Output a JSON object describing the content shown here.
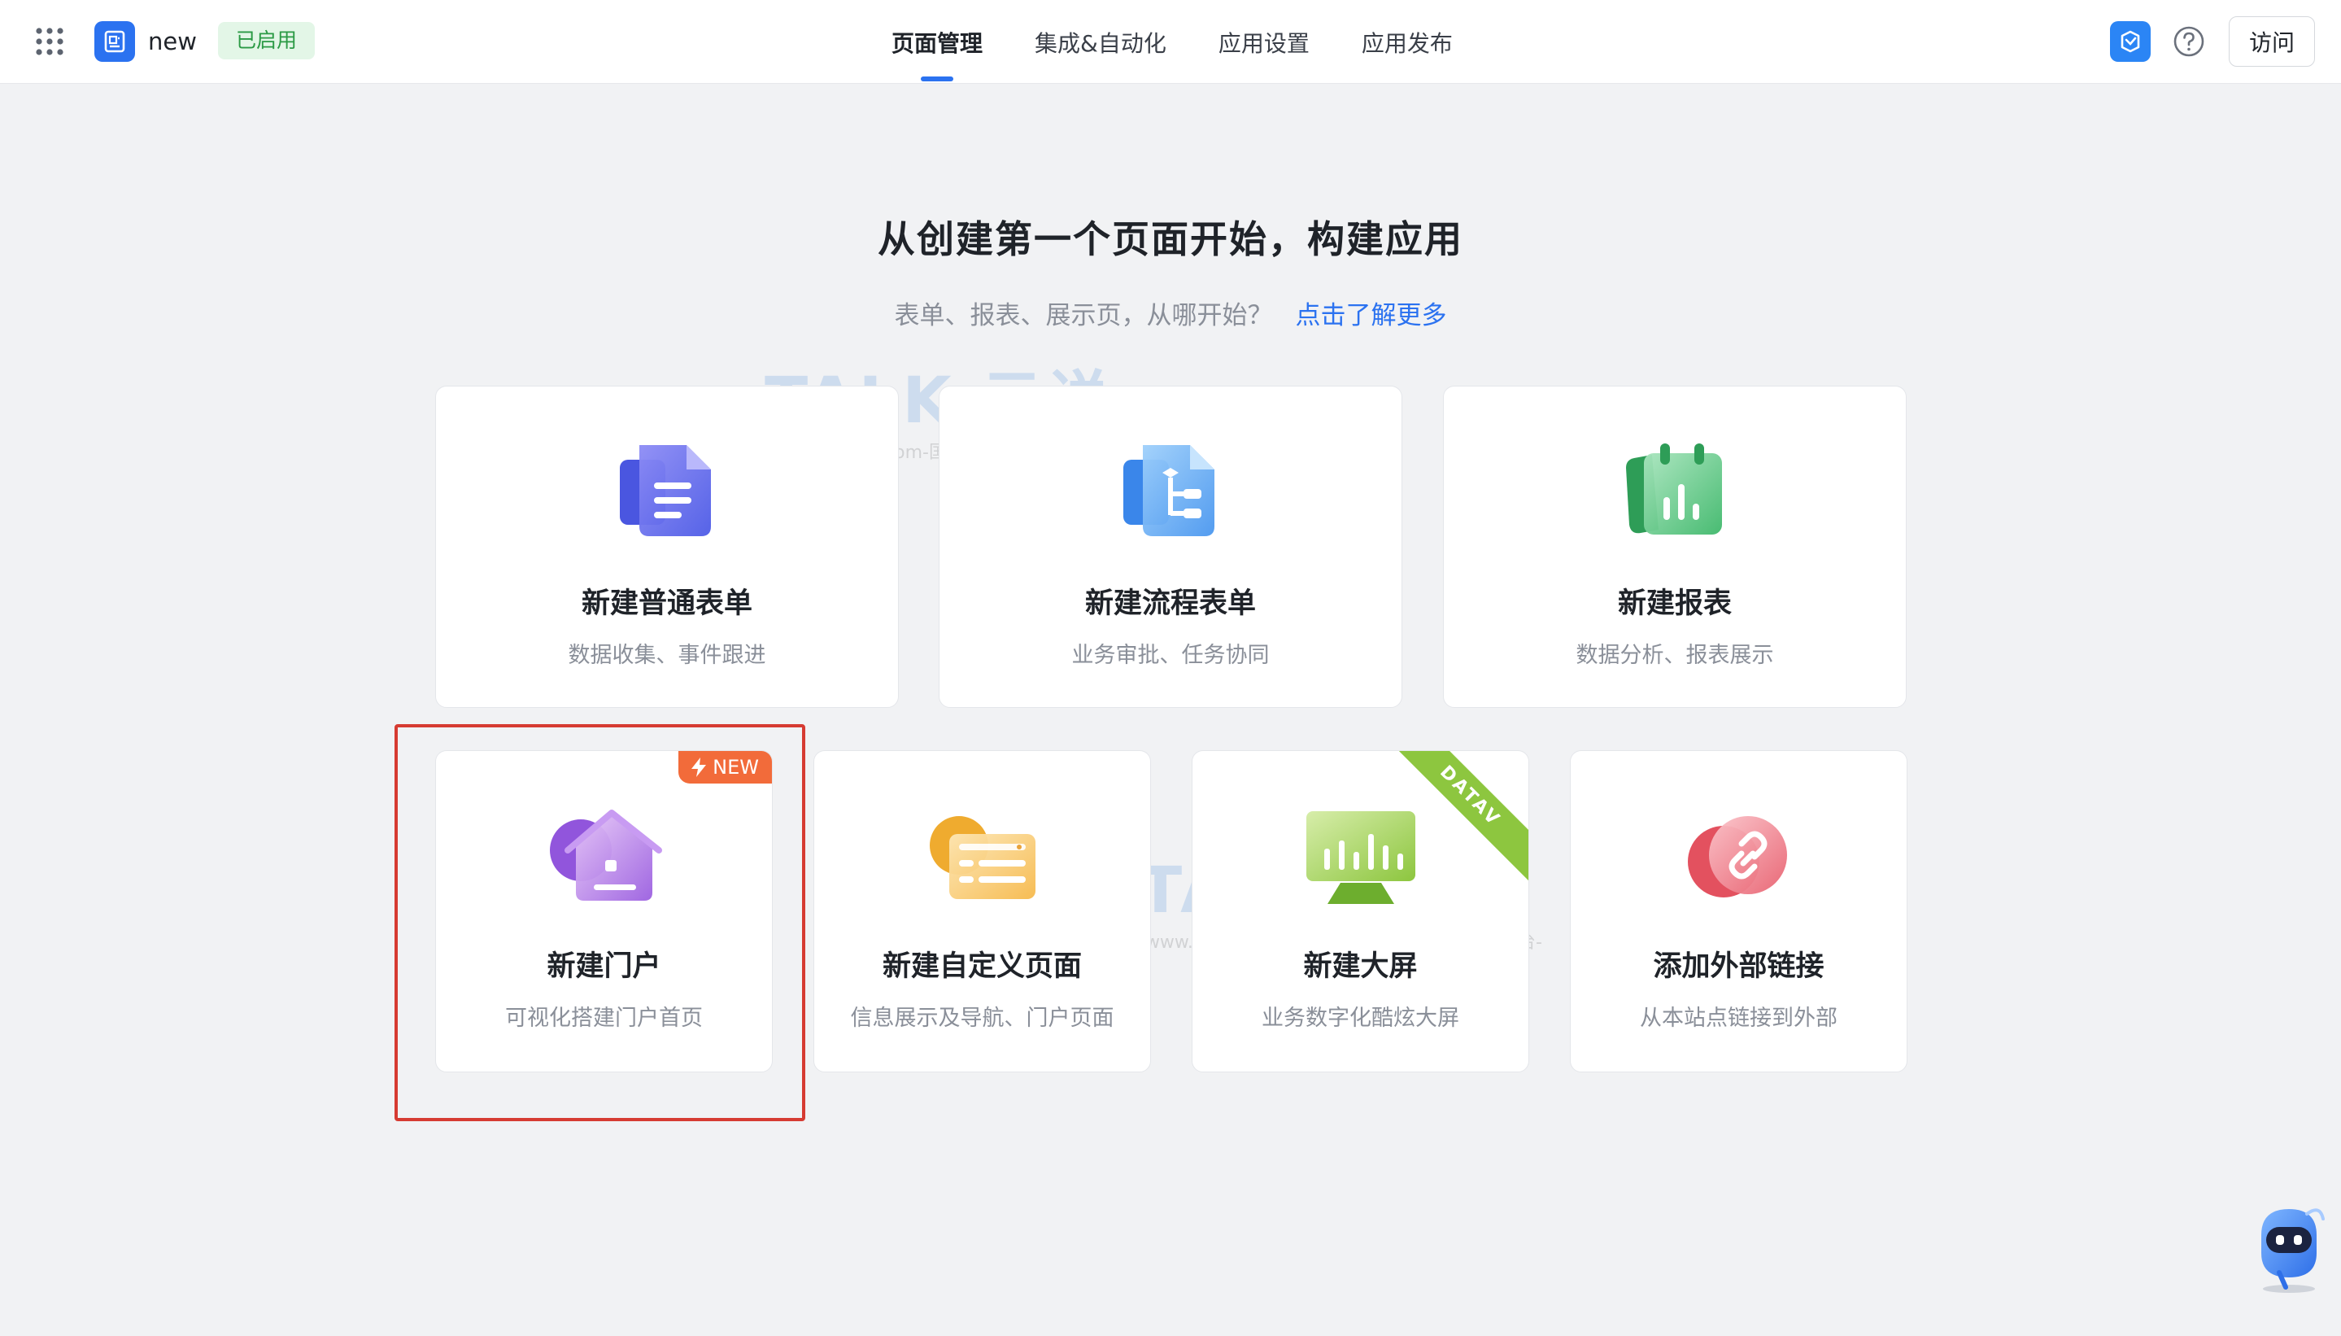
{
  "header": {
    "app_name": "new",
    "status_badge": "已启用",
    "nav_tabs": [
      {
        "label": "页面管理",
        "active": true
      },
      {
        "label": "集成&自动化",
        "active": false
      },
      {
        "label": "应用设置",
        "active": false
      },
      {
        "label": "应用发布",
        "active": false
      }
    ],
    "visit_label": "访问",
    "icons": [
      "grid-icon",
      "app-form-icon",
      "brand-icon",
      "help-icon"
    ]
  },
  "main": {
    "title": "从创建第一个页面开始，构建应用",
    "subtitle": "表单、报表、展示页，从哪开始？",
    "learn_more_link": "点击了解更多",
    "cards": [
      {
        "title": "新建普通表单",
        "desc": "数据收集、事件跟进",
        "icon": "form-icon"
      },
      {
        "title": "新建流程表单",
        "desc": "业务审批、任务协同",
        "icon": "flow-form-icon"
      },
      {
        "title": "新建报表",
        "desc": "数据分析、报表展示",
        "icon": "report-icon"
      },
      {
        "title": "新建门户",
        "desc": "可视化搭建门户首页",
        "icon": "portal-icon",
        "badge": "NEW",
        "highlighted": true
      },
      {
        "title": "新建自定义页面",
        "desc": "信息展示及导航、门户页面",
        "icon": "custom-page-icon"
      },
      {
        "title": "新建大屏",
        "desc": "业务数字化酷炫大屏",
        "icon": "big-screen-icon",
        "ribbon": "DATAV"
      },
      {
        "title": "添加外部链接",
        "desc": "从本站点链接到外部",
        "icon": "link-icon"
      }
    ]
  },
  "watermark": {
    "text": "TALK 云说",
    "sub": "-www.idctalk.com-国内专业云计算交流服务平台-"
  },
  "colors": {
    "accent": "#2b72f0",
    "status_green": "#2b9a45",
    "highlight_red": "#d63b32",
    "new_badge": "#f26b3a",
    "ribbon_green": "#8dc63f"
  }
}
